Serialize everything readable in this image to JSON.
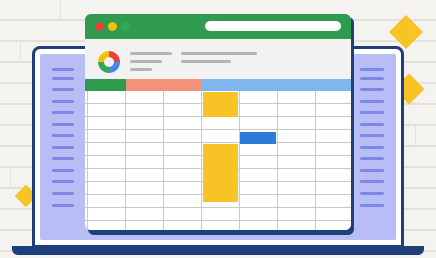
{
  "illustration": {
    "colors": {
      "window_header": "#2e9b4e",
      "laptop_frame": "#1f3f7a",
      "laptop_screen": "#b8bdf5",
      "highlight_yellow": "#f7c325",
      "highlight_blue": "#2b7bd8",
      "column_header_salmon": "#f4917a",
      "column_header_blue": "#7fb6ee",
      "column_header_green": "#2e9b4e",
      "wall": "#f4f3ef"
    },
    "window_controls": [
      "close-dot",
      "minimize-dot",
      "maximize-dot"
    ],
    "logo_icon": "google-spreadsheet-logo-icon"
  }
}
